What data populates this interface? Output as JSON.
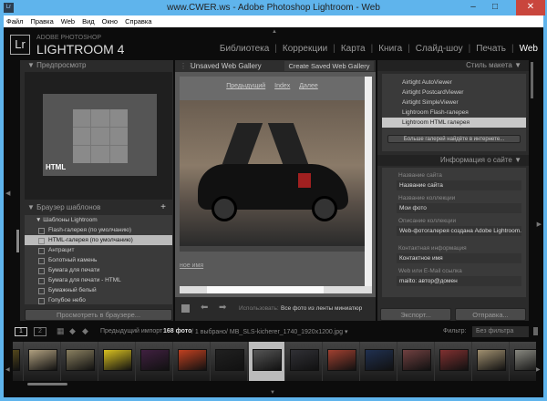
{
  "window": {
    "title": "www.CWER.ws - Adobe Photoshop Lightroom - Web",
    "minimize": "–",
    "maximize": "□",
    "close": "✕"
  },
  "menu": [
    "Файл",
    "Правка",
    "Web",
    "Вид",
    "Окно",
    "Справка"
  ],
  "logo": {
    "badge": "Lr",
    "sub": "ADOBE PHOTOSHOP",
    "main": "LIGHTROOM 4"
  },
  "modules": [
    "Библиотека",
    "Коррекции",
    "Карта",
    "Книга",
    "Слайд-шоу",
    "Печать",
    "Web"
  ],
  "left": {
    "preview_title": "Предпросмотр",
    "preview_badge": "HTML",
    "browser_title": "Браузер шаблонов",
    "add": "+",
    "folder": "Шаблоны Lightroom",
    "templates": [
      "Flash-галерея (по умолчанию)",
      "HTML-галерея (по умолчанию)",
      "Антрацит",
      "Болотный камень",
      "Бумага для печати",
      "Бумага для печати - HTML",
      "Бумажный белый",
      "Голубое небо"
    ],
    "selected_template": 1,
    "preview_button": "Просмотреть в браузере..."
  },
  "center": {
    "gallery_name": "Unsaved Web Gallery",
    "create_button": "Create Saved Web Gallery",
    "nav": [
      "Предыдущий",
      "Index",
      "Далее"
    ],
    "contact_link": "ное имя",
    "use_label": "Использовать:",
    "use_value": "Все фото из ленты миниатюр"
  },
  "right": {
    "layout_title": "Стиль макета",
    "styles": [
      "Airtight AutoViewer",
      "Airtight PostcardViewer",
      "Airtight SimpleViewer",
      "Lightroom Flash-галерея",
      "Lightroom HTML галерея"
    ],
    "selected_style": 4,
    "more_button": "Больше галерей найдёте в интернете...",
    "site_title": "Информация о сайте",
    "fields": [
      {
        "label": "Название сайта",
        "value": "Название сайта"
      },
      {
        "label": "Название коллекции",
        "value": "Мои фото"
      },
      {
        "label": "Описание коллекции",
        "value": "Web-фотогалерея создана Adobe Lightroom."
      },
      {
        "label": "Контактная информация",
        "value": "Контактное имя"
      },
      {
        "label": "Web или E-Mail ссылка",
        "value": "mailto: автор@домен"
      }
    ],
    "export_button": "Экспорт...",
    "upload_button": "Отправка..."
  },
  "filmstrip": {
    "screen1": "1",
    "screen2": "2",
    "source": "Предыдущий импорт",
    "count": "168 фото",
    "selection": "/ 1 выбрано/ MB_SLS-kicherer_1740_1920x1200.jpg ▾",
    "filter_label": "Фильтр:",
    "filter_value": "Без фильтра",
    "thumb_colors": [
      "#6a5a20",
      "#b0a080",
      "#8a8060",
      "#d8c020",
      "#402040",
      "#c04020",
      "#202020",
      "#555555",
      "#303035",
      "#a04030",
      "#203050",
      "#704040",
      "#803030",
      "#a09070",
      "#888880"
    ],
    "selected_thumb": 7
  }
}
